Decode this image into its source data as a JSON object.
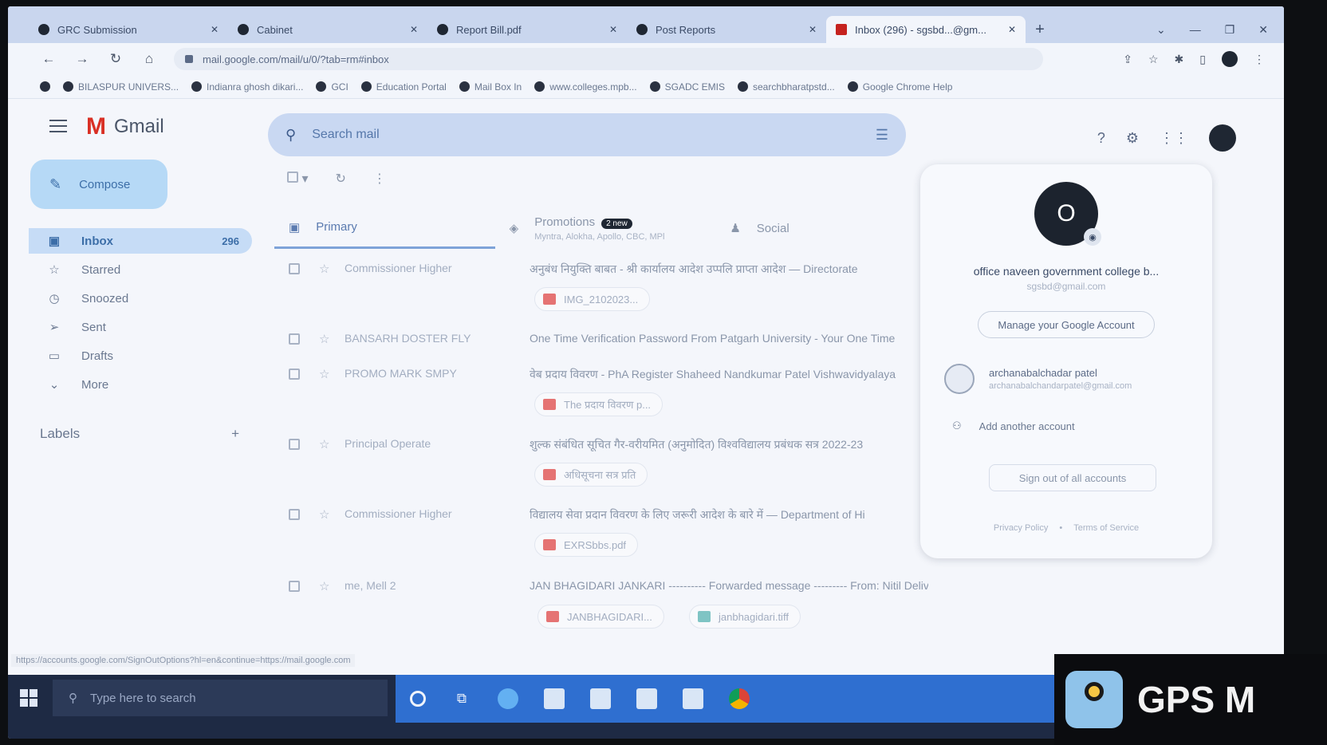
{
  "browser": {
    "tabs": [
      {
        "label": "GRC Submission",
        "active": false
      },
      {
        "label": "Cabinet",
        "active": false
      },
      {
        "label": "Report Bill.pdf",
        "active": false
      },
      {
        "label": "Post Reports",
        "active": false
      },
      {
        "label": "Inbox (296) - sgsbd...@gm...",
        "active": true
      }
    ],
    "url": "mail.google.com/mail/u/0/?tab=rm#inbox",
    "bookmarks": [
      "BILASPUR UNIVERS...",
      "Indianra ghosh dikari...",
      "GCI",
      "Education Portal",
      "Mail Box In",
      "www.colleges.mpb...",
      "SGADC EMIS",
      "searchbharatpstd...",
      "Google Chrome Help"
    ]
  },
  "gmail": {
    "brand": "Gmail",
    "search_placeholder": "Search mail",
    "compose_label": "Compose",
    "nav": [
      {
        "label": "Inbox",
        "count": "296",
        "icon": "inbox-icon",
        "active": true
      },
      {
        "label": "Starred",
        "count": "",
        "icon": "star-icon",
        "active": false
      },
      {
        "label": "Snoozed",
        "count": "",
        "icon": "clock-icon",
        "active": false
      },
      {
        "label": "Sent",
        "count": "",
        "icon": "send-icon",
        "active": false
      },
      {
        "label": "Drafts",
        "count": "",
        "icon": "draft-icon",
        "active": false
      },
      {
        "label": "More",
        "count": "",
        "icon": "chevron-down-icon",
        "active": false
      }
    ],
    "labels_heading": "Labels",
    "inbox_tabs": [
      {
        "label": "Primary",
        "badge": "",
        "subtitle": ""
      },
      {
        "label": "Promotions",
        "badge": "2 new",
        "subtitle": "Myntra, Alokha, Apollo, CBC, MPl"
      },
      {
        "label": "Social",
        "badge": "",
        "subtitle": ""
      }
    ],
    "emails": [
      {
        "sender": "Commissioner Higher",
        "subject": "अनुबंध नियुक्ति बाबत - श्री कार्यालय आदेश उप्पलि प्राप्ता आदेश — Directorate",
        "attachments": [
          {
            "name": "IMG_2102023...",
            "type": "pdf"
          }
        ]
      },
      {
        "sender": "BANSARH DOSTER FLY",
        "subject": "One Time Verification Password From Patgarh University - Your One Time",
        "attachments": []
      },
      {
        "sender": "PROMO MARK SMPY",
        "subject": "वेब प्रदाय विवरण - PhA Register Shaheed Nandkumar Patel Vishwavidyalaya",
        "attachments": [
          {
            "name": "The प्रदाय विवरण p...",
            "type": "pdf"
          }
        ]
      },
      {
        "sender": "Principal Operate",
        "subject": "शुल्क संबंधित सूचित गैर-वरीयमित (अनुमोदित) विश्वविद्यालय प्रबंधक सत्र 2022-23",
        "attachments": [
          {
            "name": "अधिसूचना सत्र प्रति",
            "type": "pdf"
          }
        ]
      },
      {
        "sender": "Commissioner Higher",
        "subject": "विद्यालय सेवा प्रदान विवरण के लिए जरूरी आदेश के बारे में — Department of Hi",
        "attachments": [
          {
            "name": "EXRSbbs.pdf",
            "type": "pdf"
          }
        ]
      },
      {
        "sender": "me, Mell 2",
        "subject": "JAN BHAGIDARI JANKARI ---------- Forwarded message --------- From: Nitil Delivery Subsystem <mailer",
        "attachments": [
          {
            "name": "JANBHAGIDARI...",
            "type": "pdf"
          },
          {
            "name": "janbhagidari.tiff",
            "type": "img"
          }
        ]
      }
    ],
    "status_url": "https://accounts.google.com/SignOutOptions?hl=en&continue=https://mail.google.com"
  },
  "account": {
    "initial": "O",
    "name": "office naveen government college b...",
    "email": "sgsbd@gmail.com",
    "manage_label": "Manage your Google Account",
    "other_account": {
      "name": "archanabalchadar patel",
      "email": "archanabalchandarpatel@gmail.com"
    },
    "add_account_label": "Add another account",
    "signout_label": "Sign out of all accounts",
    "footer": [
      "Privacy Policy",
      "•",
      "Terms of Service"
    ]
  },
  "taskbar": {
    "search_placeholder": "Type here to search"
  },
  "overlay": {
    "gps_text": "GPS M"
  },
  "colors": {
    "accent": "#2f6fd0",
    "gmail_red": "#d93025",
    "selected_nav": "#c6dcf6",
    "compose": "#b6d9f6"
  }
}
